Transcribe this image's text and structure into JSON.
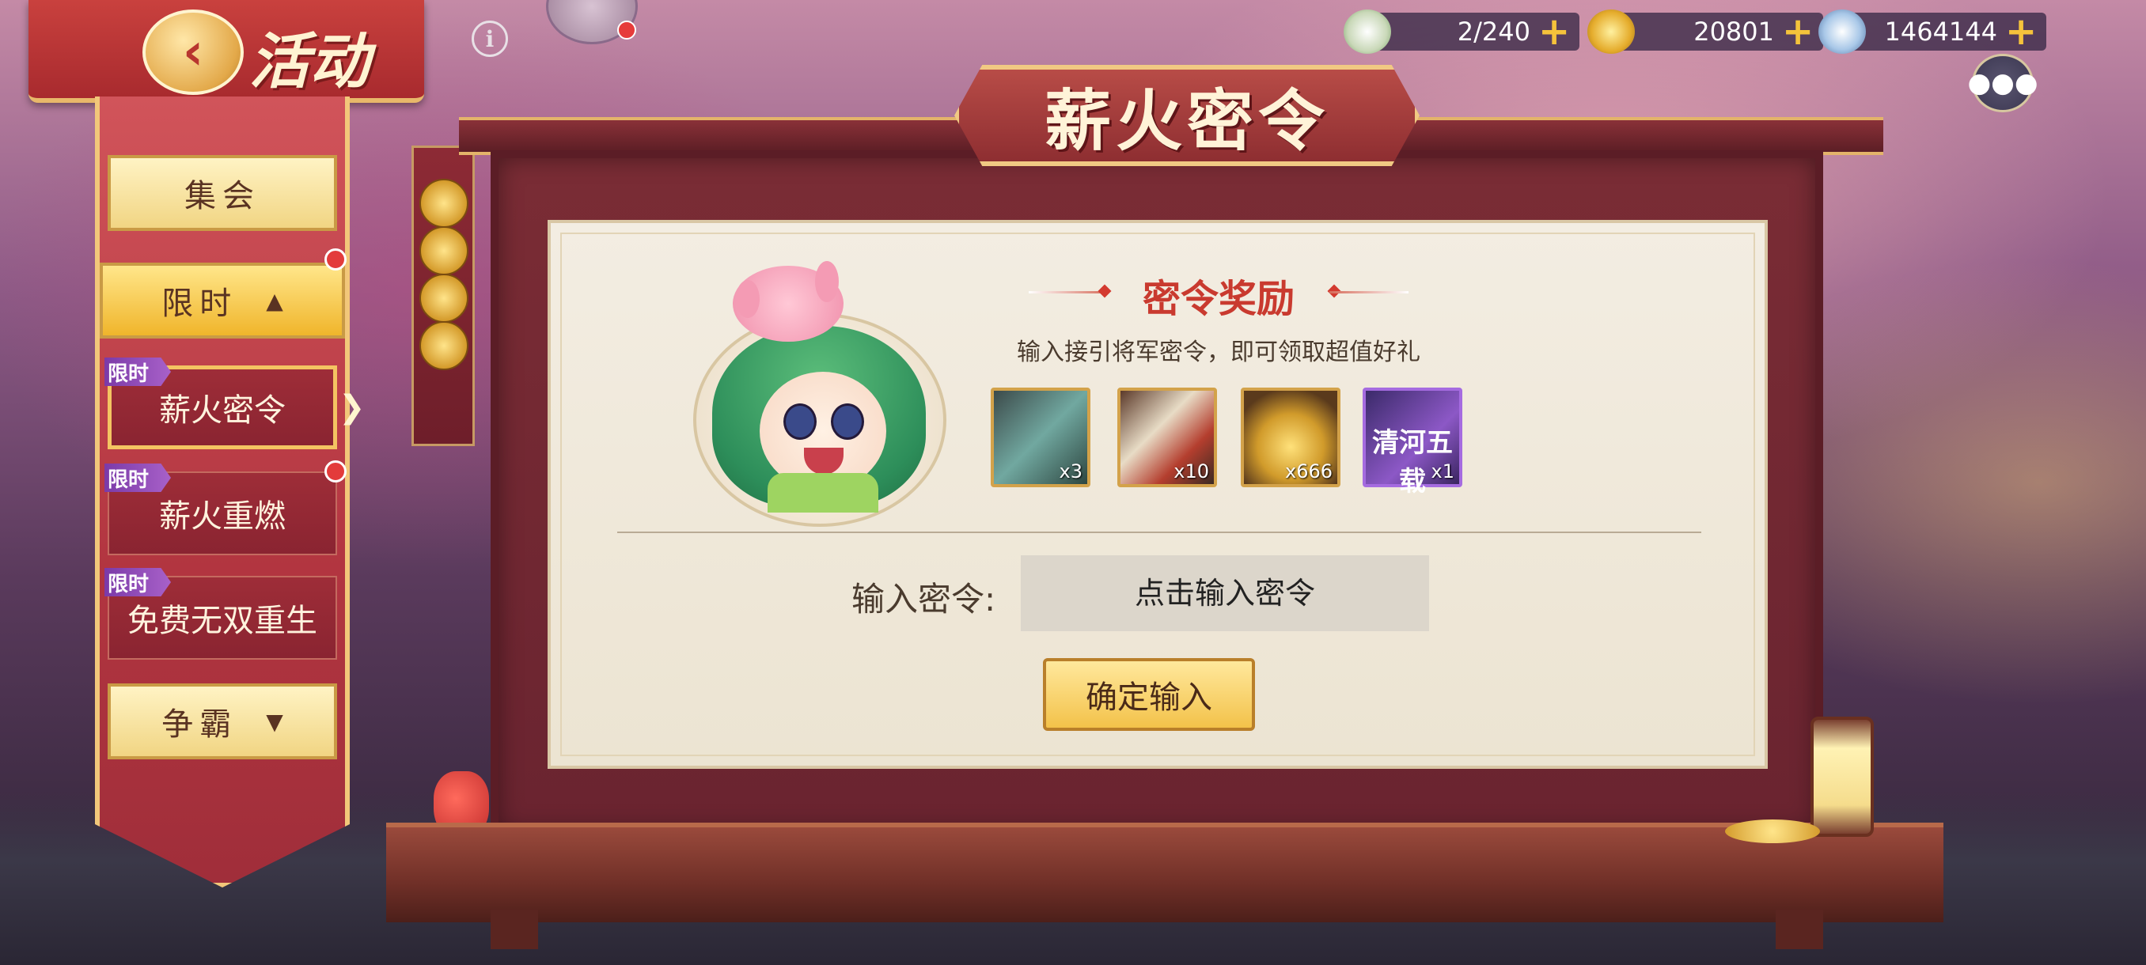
{
  "header": {
    "title": "活动",
    "back_icon": "back-arrow-icon",
    "info_icon": "i"
  },
  "currency": {
    "stamina": "2/240",
    "gold": "20801",
    "coins": "1464144",
    "plus": "+"
  },
  "menu": {
    "jihui": "集会",
    "xianshi": "限时",
    "zhengba": "争霸",
    "items": [
      {
        "tag": "限时",
        "label": "薪火密令"
      },
      {
        "tag": "限时",
        "label": "薪火重燃"
      },
      {
        "tag": "限时",
        "label": "免费无双重生"
      }
    ]
  },
  "panel": {
    "title": "薪火密令",
    "reward_title": "密令奖励",
    "reward_desc": "输入接引将军密令，即可领取超值好礼",
    "rewards": [
      {
        "qty": "x3",
        "icon": "jade-token-icon"
      },
      {
        "qty": "x10",
        "icon": "scroll-portrait-icon"
      },
      {
        "qty": "x666",
        "icon": "gold-ingot-icon"
      },
      {
        "qty": "x1",
        "icon": "frame-card-icon",
        "text": "清河五载"
      }
    ],
    "input_label": "输入密令:",
    "input_placeholder": "点击输入密令",
    "confirm_label": "确定输入"
  },
  "colors": {
    "accent_red": "#c93a2f",
    "gold": "#f3c24a",
    "purple_tag": "#8b47b5"
  }
}
